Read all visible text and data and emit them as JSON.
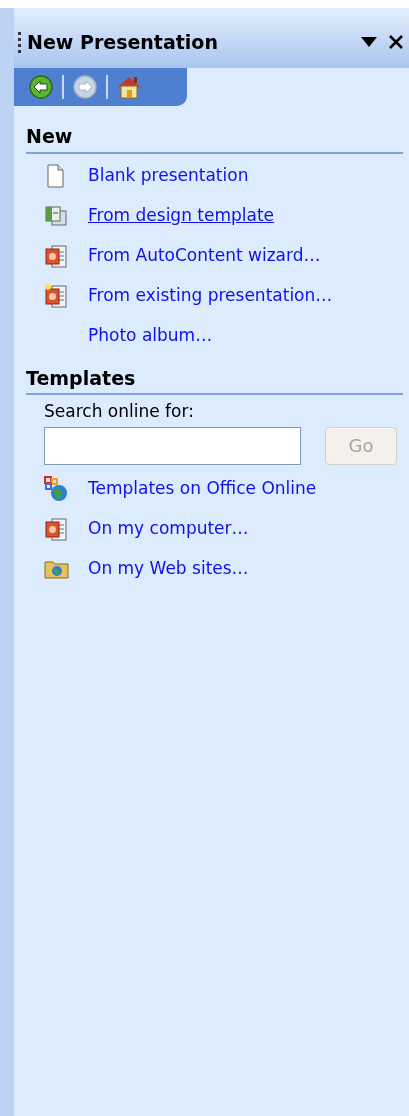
{
  "pane": {
    "title": "New Presentation"
  },
  "nav": [
    {
      "kind": "back",
      "disabled": false
    },
    {
      "kind": "forward",
      "disabled": true
    },
    {
      "kind": "home",
      "disabled": false
    }
  ],
  "sections": [
    {
      "heading": "New",
      "items": [
        {
          "label": "Blank presentation",
          "kind": "blank",
          "hovered": false
        },
        {
          "label": "From design template",
          "kind": "design",
          "hovered": true
        },
        {
          "label": "From AutoContent wizard…",
          "kind": "wizard",
          "hovered": false
        },
        {
          "label": "From existing presentation…",
          "kind": "existing",
          "hovered": false
        },
        {
          "label": "Photo album…",
          "kind": "none",
          "hovered": false
        }
      ]
    },
    {
      "heading": "Templates",
      "search": {
        "label": "Search online for:",
        "button": "Go",
        "button_disabled": true
      },
      "items": [
        {
          "label": "Templates on Office Online",
          "kind": "online",
          "hovered": false
        },
        {
          "label": "On my computer…",
          "kind": "computer",
          "hovered": false
        },
        {
          "label": "On my Web sites…",
          "kind": "websites",
          "hovered": false
        }
      ]
    }
  ]
}
